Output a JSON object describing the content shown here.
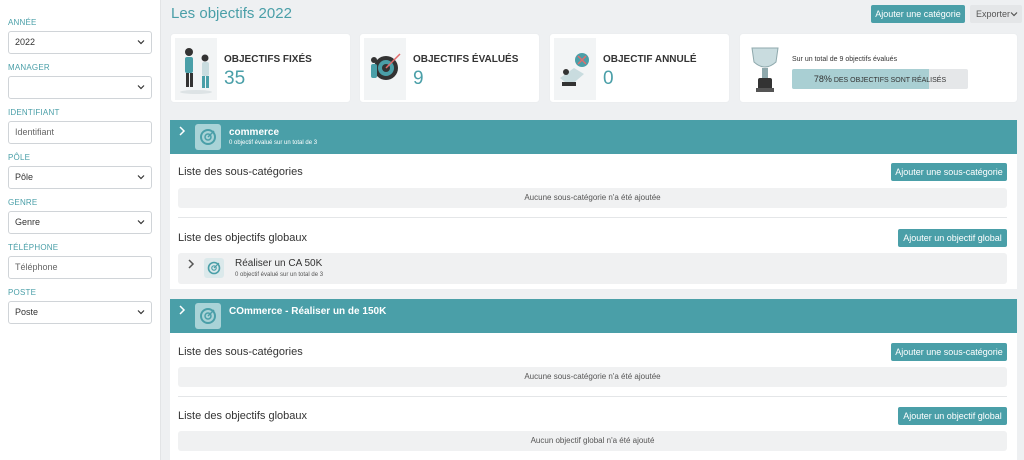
{
  "sidebar": {
    "annee_label": "ANNÉE",
    "annee_value": "2022",
    "manager_label": "MANAGER",
    "manager_value": "",
    "identifiant_label": "IDENTIFIANT",
    "identifiant_placeholder": "Identifiant",
    "pole_label": "PÔLE",
    "pole_value": "Pôle",
    "genre_label": "GENRE",
    "genre_value": "Genre",
    "telephone_label": "TÉLÉPHONE",
    "telephone_placeholder": "Téléphone",
    "poste_label": "POSTE",
    "poste_value": "Poste"
  },
  "header": {
    "title": "Les objectifs 2022",
    "add_category_label": "Ajouter une catégorie",
    "export_label": "Exporter"
  },
  "stats": {
    "fixed_label": "OBJECTIFS FIXÉS",
    "fixed_value": "35",
    "evaluated_label": "OBJECTIFS ÉVALUÉS",
    "evaluated_value": "9",
    "cancelled_label": "OBJECTIF ANNULÉ",
    "cancelled_value": "0",
    "total_text": "Sur un total de 9 objectifs évalués",
    "progress_percent": "78%",
    "progress_fraction": 0.78,
    "progress_caption": " DES OBJECTIFS SONT RÉALISÉS"
  },
  "categories": [
    {
      "name": "commerce",
      "subtitle": "0 objectif évalué sur un total de 3",
      "subcat_title": "Liste des sous-catégories",
      "add_subcat_label": "Ajouter une sous-catégorie",
      "subcat_empty": "Aucune sous-catégorie n'a été ajoutée",
      "global_title": "Liste des objectifs globaux",
      "add_global_label": "Ajouter un objectif global",
      "objectives": [
        {
          "name": "Réaliser un CA 50K",
          "subtitle": "0 objectif évalué sur un total de 3"
        }
      ]
    },
    {
      "name": "COmmerce - Réaliser un de 150K",
      "subtitle": "",
      "subcat_title": "Liste des sous-catégories",
      "add_subcat_label": "Ajouter une sous-catégorie",
      "subcat_empty": "Aucune sous-catégorie n'a été ajoutée",
      "global_title": "Liste des objectifs globaux",
      "add_global_label": "Ajouter un objectif global",
      "global_empty": "Aucun objectif global n'a été ajouté"
    }
  ],
  "colors": {
    "accent": "#4a9fa8",
    "accent_light": "#a9cfd3",
    "background": "#eef0f2"
  }
}
